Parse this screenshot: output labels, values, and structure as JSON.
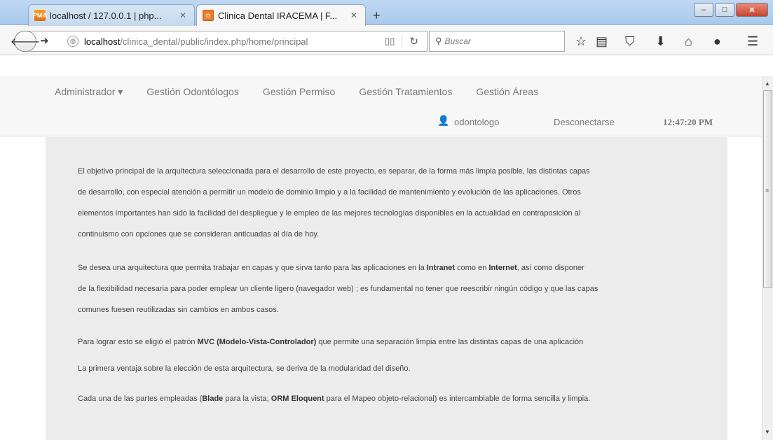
{
  "browser": {
    "tabs": [
      {
        "title": "localhost / 127.0.0.1 | php...",
        "favicon": "PMA",
        "active": false
      },
      {
        "title": "Clinica Dental IRACEMA | F...",
        "favicon": "",
        "active": true
      }
    ],
    "address": {
      "host": "localhost",
      "path": "/clinica_dental/public/index.php/home/principal"
    },
    "search_placeholder": "Buscar",
    "window_controls": {
      "minimize": "–",
      "maximize": "□",
      "close": "✕"
    }
  },
  "app": {
    "menu": [
      "Administrador ▾",
      "Gestión Odontólogos",
      "Gestión Permiso",
      "Gestión Tratamientos",
      "Gestión Áreas"
    ],
    "user": "odontologo",
    "logout": "Desconectarse",
    "time": "12:47:20 PM"
  },
  "content": {
    "p1": [
      "El objetivo principal de la arquitectura seleccionada para el desarrollo de este proyecto, es separar, de la forma más limpia posible, las distintas capas",
      "de desarrollo, con especial atención a permitir un modelo de dominio limpio y a la facilidad de mantenimiento y evolución de las aplicaciones. Otros",
      "elementos importantes han sido la facilidad del despliegue y le empleo de las mejores tecnologías disponibles en la actualidad en contraposición al",
      "continuismo con opciones que se consideran anticuadas al día de hoy."
    ],
    "p2": {
      "line1_a": "Se desea una arquitectura que permita trabajar en capas y que sirva tanto para las aplicaciones en la ",
      "intranet": "Intranet",
      "line1_b": " como en ",
      "internet": "Internet",
      "line1_c": ", así como disponer",
      "line2": "de la flexibilidad necesaria para poder emplear un cliente ligero (navegador web) ; es fundamental no tener que reescribir ningún código y que las capas",
      "line3": "comunes fuesen reutilizadas sin cambios en ambos casos."
    },
    "p3": {
      "a": "Para lograr esto se eligió el patrón ",
      "mvc": "MVC (Modelo-Vista-Controlador)",
      "b": " que permite una separación limpia entre las distintas capas de una aplicación"
    },
    "p4": "La primera ventaja sobre la elección de esta arquitectura, se deriva de la modularidad del diseño.",
    "p5": {
      "a": "Cada una de las partes empleadas (",
      "blade": "Blade",
      "b": " para la vista, ",
      "orm": "ORM Eloquent",
      "c": " para el Mapeo objeto-relacional) es intercambiable de forma sencilla y limpia."
    }
  },
  "colors": {
    "titlebar": "#a9c9ec",
    "nav_bg": "#f7f7f7",
    "content_bg": "#ececec",
    "close_btn": "#c7452e"
  }
}
